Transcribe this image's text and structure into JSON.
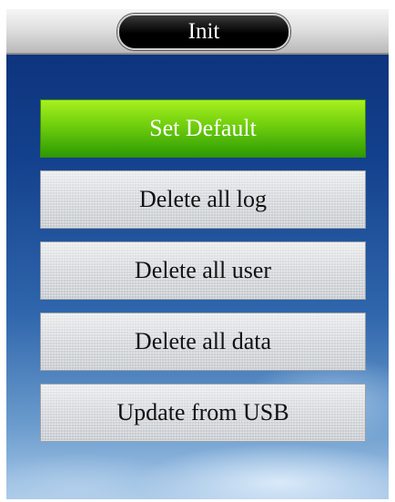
{
  "window": {
    "title": "Init"
  },
  "menu": {
    "items": [
      {
        "label": "Set Default",
        "selected": true
      },
      {
        "label": "Delete all log",
        "selected": false
      },
      {
        "label": "Delete all user",
        "selected": false
      },
      {
        "label": "Delete all data",
        "selected": false
      },
      {
        "label": "Update from USB",
        "selected": false
      }
    ]
  },
  "colors": {
    "selected": "#6fce0d",
    "button": "#d4d7db",
    "background": "#13408c",
    "title_pill": "#000000"
  }
}
